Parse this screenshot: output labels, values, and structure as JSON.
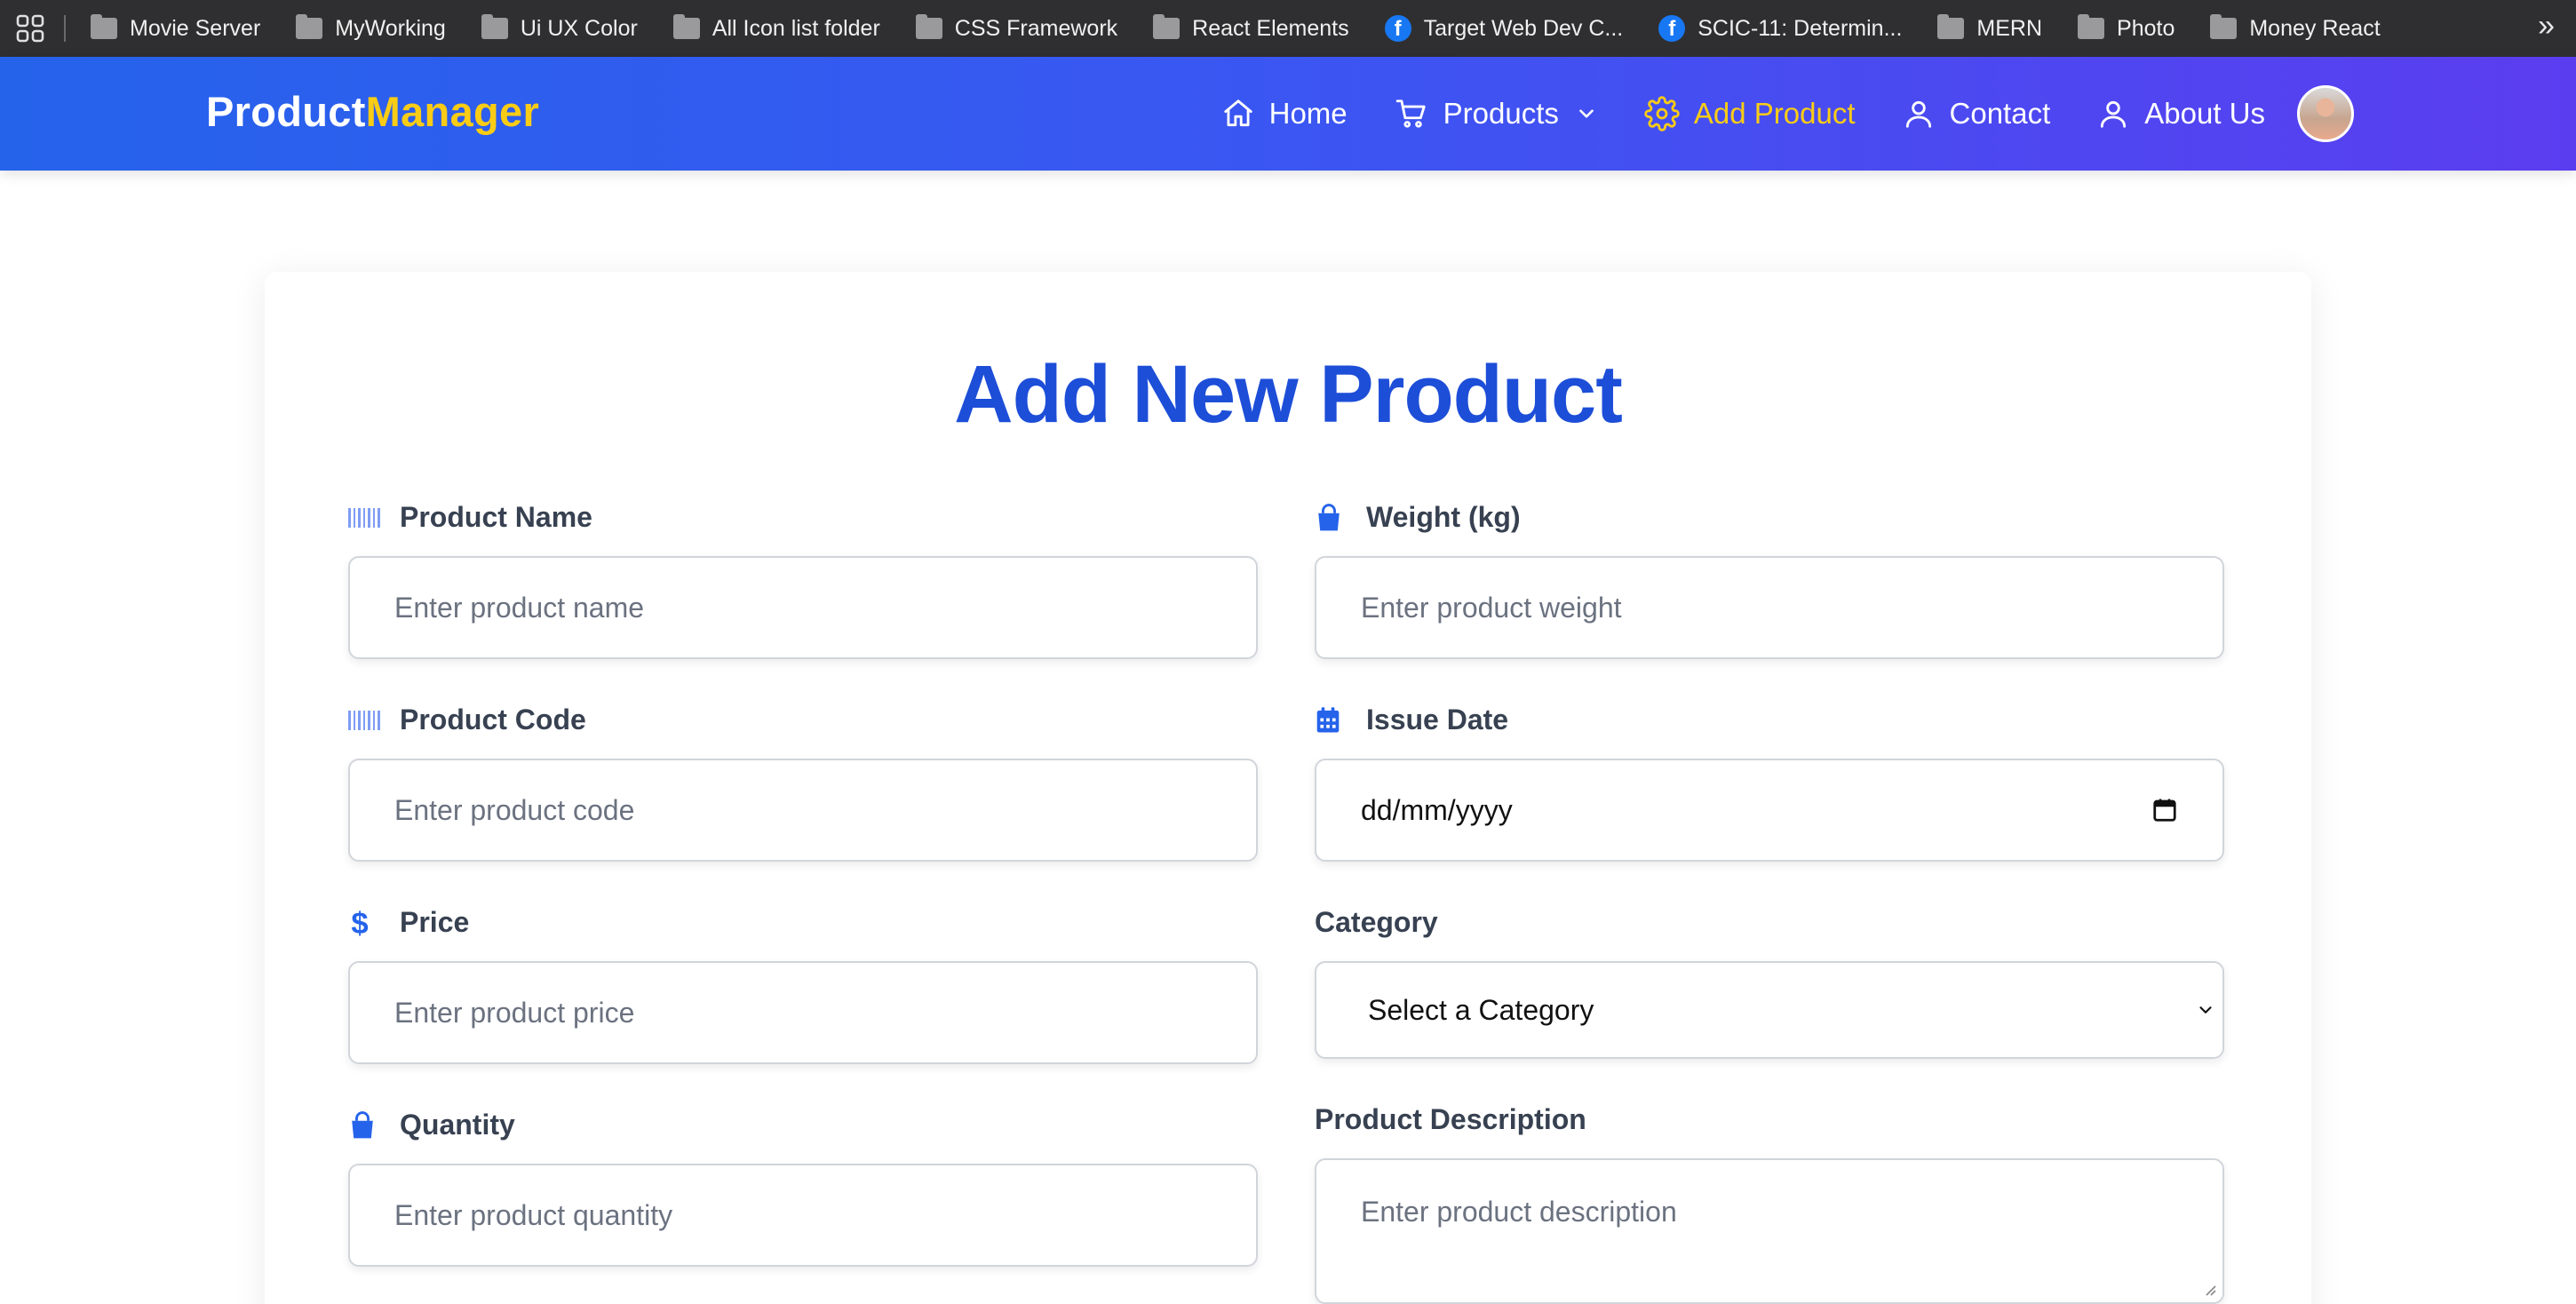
{
  "bookmarks": [
    {
      "label": "Movie Server",
      "icon": "folder-icon"
    },
    {
      "label": "MyWorking",
      "icon": "folder-icon"
    },
    {
      "label": "Ui UX Color",
      "icon": "folder-icon"
    },
    {
      "label": "All Icon list folder",
      "icon": "folder-icon"
    },
    {
      "label": "CSS Framework",
      "icon": "folder-icon"
    },
    {
      "label": "React Elements",
      "icon": "folder-icon"
    },
    {
      "label": "Target Web Dev C...",
      "icon": "facebook-icon"
    },
    {
      "label": "SCIC-11: Determin...",
      "icon": "facebook-icon"
    },
    {
      "label": "MERN",
      "icon": "folder-icon"
    },
    {
      "label": "Photo",
      "icon": "folder-icon"
    },
    {
      "label": "Money React",
      "icon": "folder-icon"
    }
  ],
  "bookmarks_more": "»",
  "navbar": {
    "brand_primary": "Product",
    "brand_accent": "Manager",
    "links": {
      "home": "Home",
      "products": "Products",
      "add_product": "Add Product",
      "contact": "Contact",
      "about": "About Us"
    },
    "active": "add_product"
  },
  "form": {
    "title": "Add New Product",
    "product_name": {
      "label": "Product Name",
      "placeholder": "Enter product name"
    },
    "product_code": {
      "label": "Product Code",
      "placeholder": "Enter product code"
    },
    "price": {
      "label": "Price",
      "placeholder": "Enter product price"
    },
    "quantity": {
      "label": "Quantity",
      "placeholder": "Enter product quantity"
    },
    "weight": {
      "label": "Weight (kg)",
      "placeholder": "Enter product weight"
    },
    "issue_date": {
      "label": "Issue Date",
      "value": "dd/mm/yyyy"
    },
    "category": {
      "label": "Category",
      "selected": "Select a Category"
    },
    "description": {
      "label": "Product Description",
      "placeholder": "Enter product description"
    }
  },
  "colors": {
    "brand_accent": "#facc15",
    "title_blue": "#1d4ed8",
    "icon_blue": "#2563eb"
  }
}
